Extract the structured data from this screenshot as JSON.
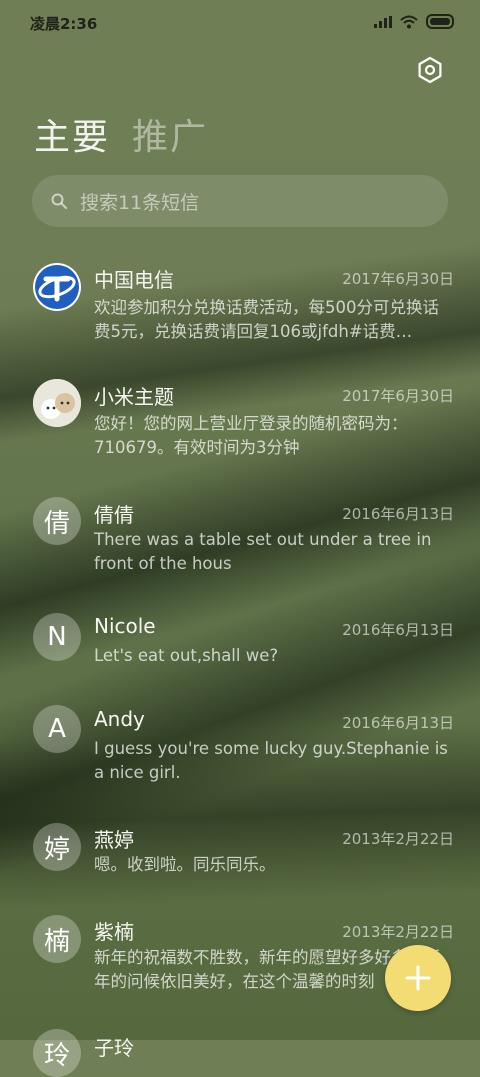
{
  "status_bar": {
    "time": "凌晨2:36"
  },
  "tabs": [
    {
      "label": "主要",
      "active": true
    },
    {
      "label": "推广",
      "active": false
    }
  ],
  "search": {
    "placeholder": "搜索11条短信"
  },
  "conversations": [
    {
      "name": "中国电信",
      "date": "2017年6月30日",
      "preview": "欢迎参加积分兑换话费活动，每500分可兑换话费5元，兑换话费请回复106或jfdh#话费…",
      "avatar": "telecom-logo"
    },
    {
      "name": "小米主题",
      "date": "2017年6月30日",
      "preview": "您好！您的网上营业厅登录的随机密码为：710679。有效时间为3分钟",
      "avatar": "pets-photo"
    },
    {
      "name": "倩倩",
      "date": "2016年6月13日",
      "preview": "There was a table set out under a tree in front of the hous",
      "avatar": "倩"
    },
    {
      "name": "Nicole",
      "date": "2016年6月13日",
      "preview": "Let's eat out,shall we?",
      "avatar": "N"
    },
    {
      "name": "Andy",
      "date": "2016年6月13日",
      "preview": "I guess you're some lucky guy.Stephanie is a nice girl.",
      "avatar": "A"
    },
    {
      "name": "燕婷",
      "date": "2013年2月22日",
      "preview": "嗯。收到啦。同乐同乐。",
      "avatar": "婷"
    },
    {
      "name": "紫楠",
      "date": "2013年2月22日",
      "preview": "新年的祝福数不胜数，新年的愿望好多好多，新年的问候依旧美好，在这个温馨的时刻",
      "avatar": "楠"
    },
    {
      "name": "子玲",
      "date": "",
      "preview": "",
      "avatar": "玲"
    }
  ],
  "fab": {
    "icon": "plus-icon"
  },
  "colors": {
    "fab": "#f3dc74",
    "telecom_blue": "#1f5fbf"
  }
}
